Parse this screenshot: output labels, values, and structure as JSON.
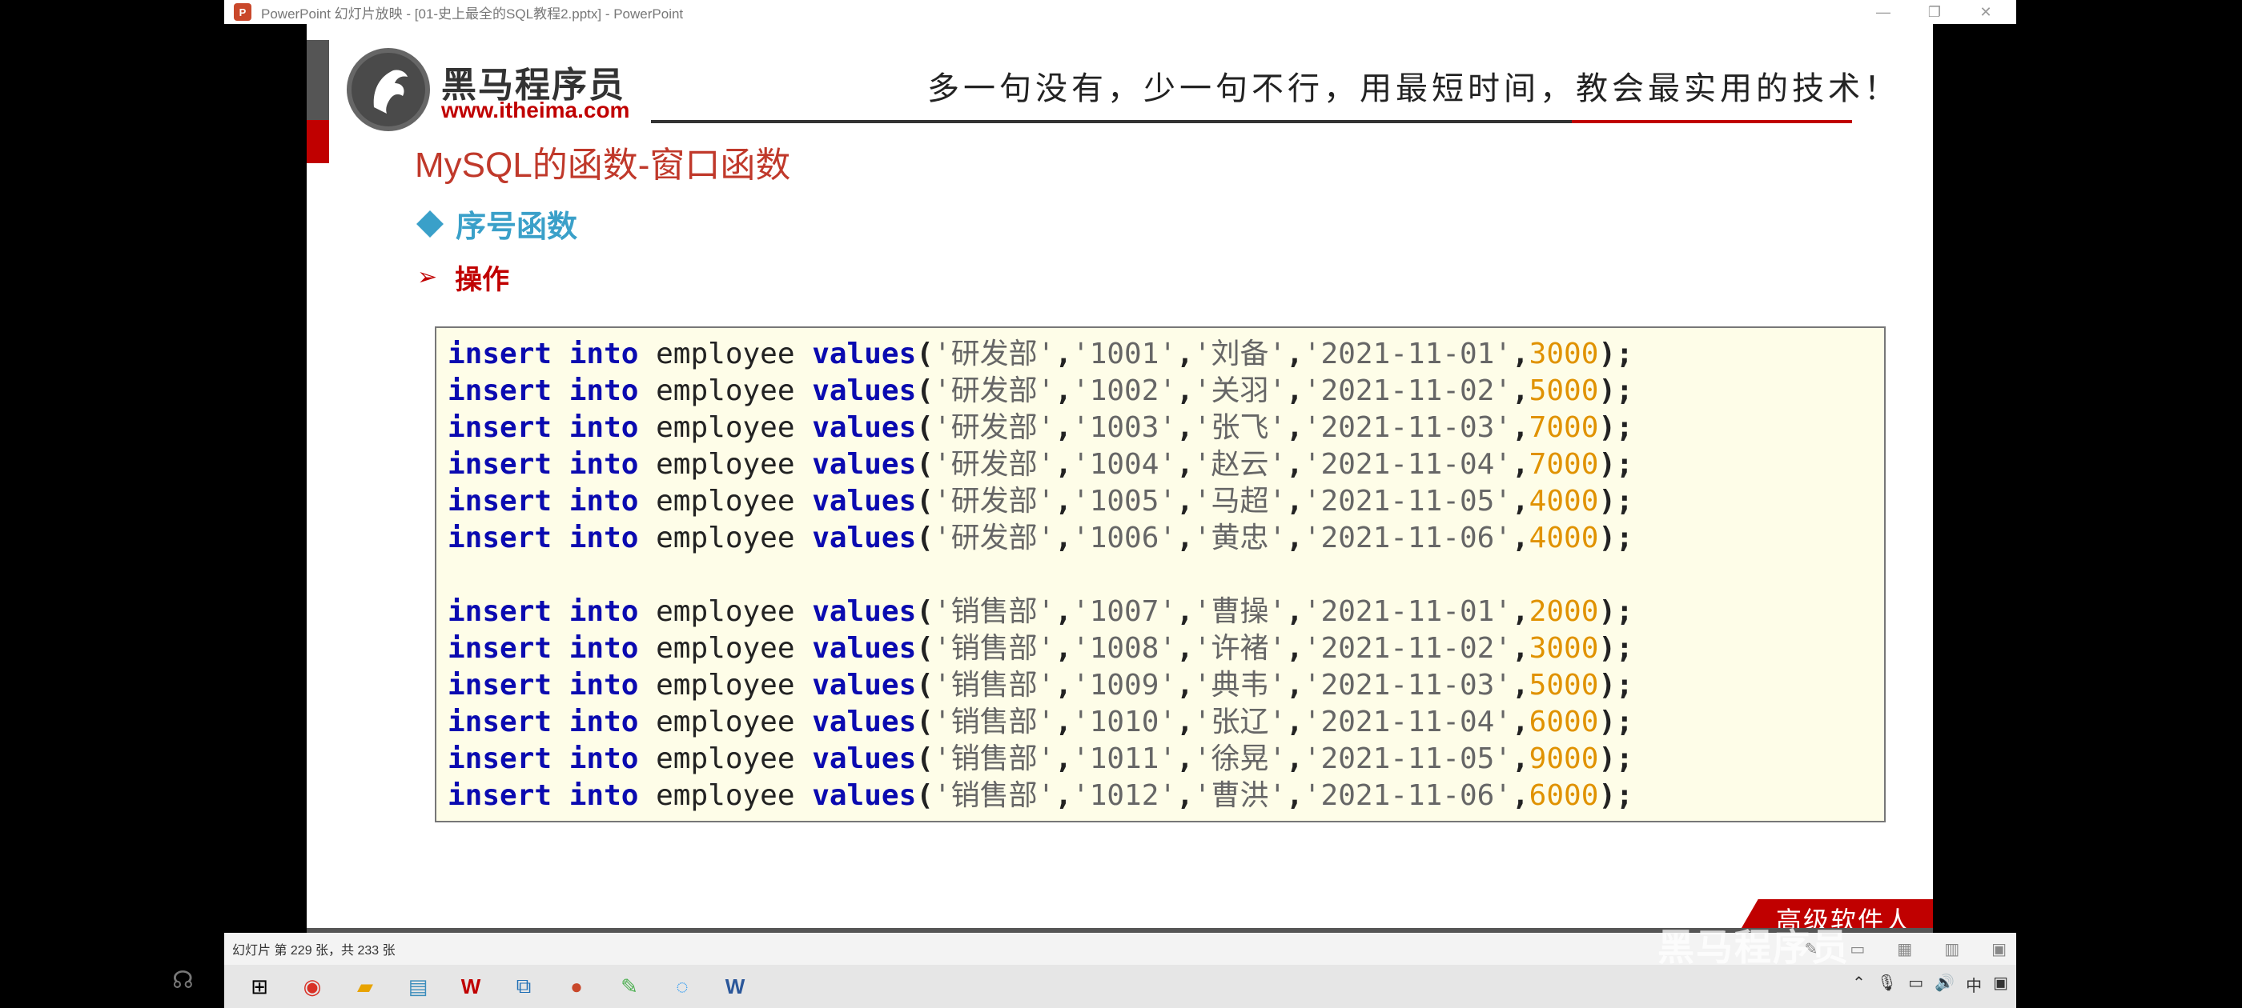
{
  "window": {
    "title": "PowerPoint 幻灯片放映 - [01-史上最全的SQL教程2.pptx] - PowerPoint",
    "app_icon": "P",
    "min_icon": "—",
    "restore_icon": "❐",
    "close_icon": "✕"
  },
  "slide": {
    "brand_name": "黑马程序员",
    "brand_url": "www.itheima.com",
    "slogan": "多一句没有，少一句不行，用最短时间，教会最实用的技术！",
    "title": "MySQL的函数-窗口函数",
    "bullet1": "序号函数",
    "bullet2": "操作",
    "footer_tag": "高级软件人才培训专家"
  },
  "code": {
    "kw_insert": "insert",
    "kw_into": "into",
    "table": "employee",
    "kw_values": "values",
    "rows": [
      {
        "dname": "研发部",
        "eid": "1001",
        "ename": "刘备",
        "hiredate": "2021-11-01",
        "salary": "3000"
      },
      {
        "dname": "研发部",
        "eid": "1002",
        "ename": "关羽",
        "hiredate": "2021-11-02",
        "salary": "5000"
      },
      {
        "dname": "研发部",
        "eid": "1003",
        "ename": "张飞",
        "hiredate": "2021-11-03",
        "salary": "7000"
      },
      {
        "dname": "研发部",
        "eid": "1004",
        "ename": "赵云",
        "hiredate": "2021-11-04",
        "salary": "7000"
      },
      {
        "dname": "研发部",
        "eid": "1005",
        "ename": "马超",
        "hiredate": "2021-11-05",
        "salary": "4000"
      },
      {
        "dname": "研发部",
        "eid": "1006",
        "ename": "黄忠",
        "hiredate": "2021-11-06",
        "salary": "4000"
      },
      {
        "dname": "销售部",
        "eid": "1007",
        "ename": "曹操",
        "hiredate": "2021-11-01",
        "salary": "2000"
      },
      {
        "dname": "销售部",
        "eid": "1008",
        "ename": "许褚",
        "hiredate": "2021-11-02",
        "salary": "3000"
      },
      {
        "dname": "销售部",
        "eid": "1009",
        "ename": "典韦",
        "hiredate": "2021-11-03",
        "salary": "5000"
      },
      {
        "dname": "销售部",
        "eid": "1010",
        "ename": "张辽",
        "hiredate": "2021-11-04",
        "salary": "6000"
      },
      {
        "dname": "销售部",
        "eid": "1011",
        "ename": "徐晃",
        "hiredate": "2021-11-05",
        "salary": "9000"
      },
      {
        "dname": "销售部",
        "eid": "1012",
        "ename": "曹洪",
        "hiredate": "2021-11-06",
        "salary": "6000"
      }
    ]
  },
  "statusbar": {
    "slide_count": "幻灯片 第 229 张，共 233 张"
  },
  "taskbar": {
    "items": [
      "windows-start",
      "chrome",
      "file-explorer",
      "notepad",
      "wps",
      "virtualbox",
      "powerpoint",
      "paint",
      "browser",
      "word"
    ]
  },
  "watermark": "黑马程序员"
}
